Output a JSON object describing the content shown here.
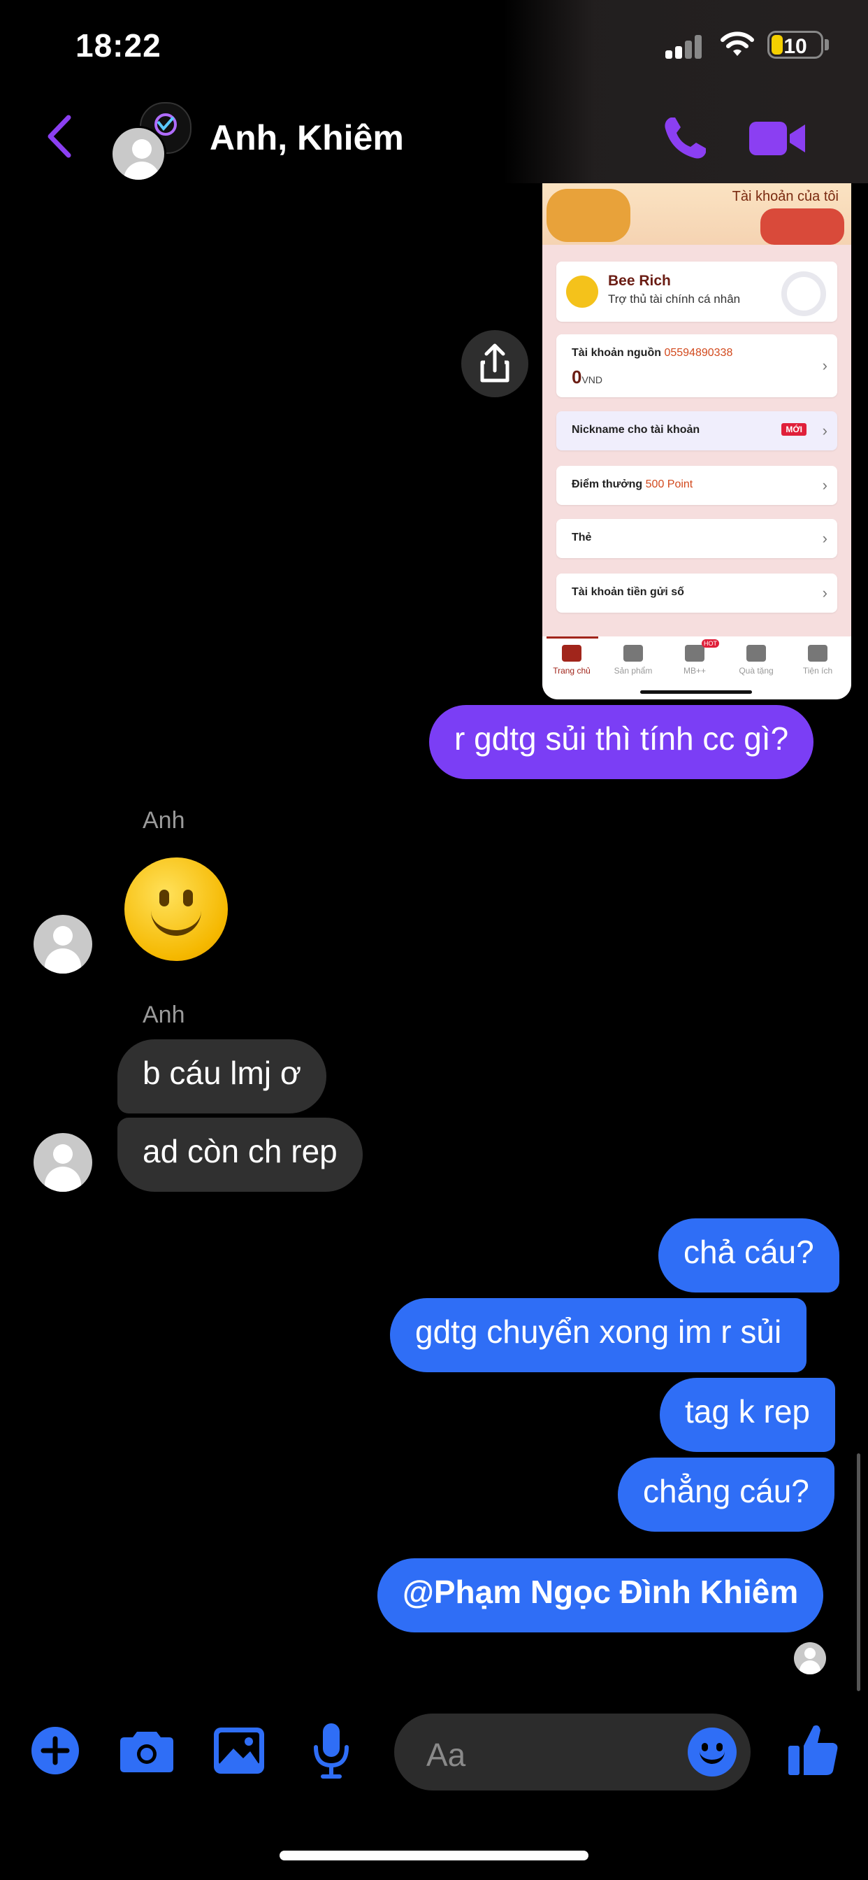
{
  "status_bar": {
    "time": "18:22",
    "battery": "10"
  },
  "header": {
    "title": "Anh, Khiêm"
  },
  "shared_image": {
    "banner_title": "Tài khoản của tôi",
    "profile_name": "Bee Rich",
    "profile_sub": "Trợ thủ tài chính cá nhân",
    "source_account_label": "Tài khoản nguồn",
    "source_account_number": "05594890338",
    "balance": "0",
    "currency": "VND",
    "nickname_label": "Nickname cho tài khoản",
    "new_badge": "MỚI",
    "points_label": "Điểm thưởng",
    "points_value": "500 Point",
    "card_label": "Thẻ",
    "savings_label": "Tài khoản tiền gửi số",
    "tabs": [
      "Trang chủ",
      "Sản phẩm",
      "MB++",
      "Quà tặng",
      "Tiện ích"
    ],
    "hot_badge": "HOT"
  },
  "messages": {
    "m1": "r gdtg sủi thì tính cc gì?",
    "sender1": "Anh",
    "sender2": "Anh",
    "m2": "b cáu lmj ơ",
    "m3": "ad còn ch rep",
    "m4": "chả cáu?",
    "m5": "gdtg chuyển xong im r sủi",
    "m6": "tag k rep",
    "m7": "chẳng cáu?",
    "m8": "@Phạm Ngọc Đình Khiêm"
  },
  "composer": {
    "placeholder": "Aa"
  },
  "icons": {
    "plus": "plus-icon",
    "camera": "camera-icon",
    "gallery": "gallery-icon",
    "mic": "microphone-icon",
    "emoji": "emoji-icon",
    "like": "thumbs-up-icon"
  },
  "colors": {
    "accent_purple": "#8b3ff2",
    "accent_blue": "#2f6ef6",
    "bubble_purple": "#7b3ef5",
    "bubble_gray": "#303030"
  }
}
